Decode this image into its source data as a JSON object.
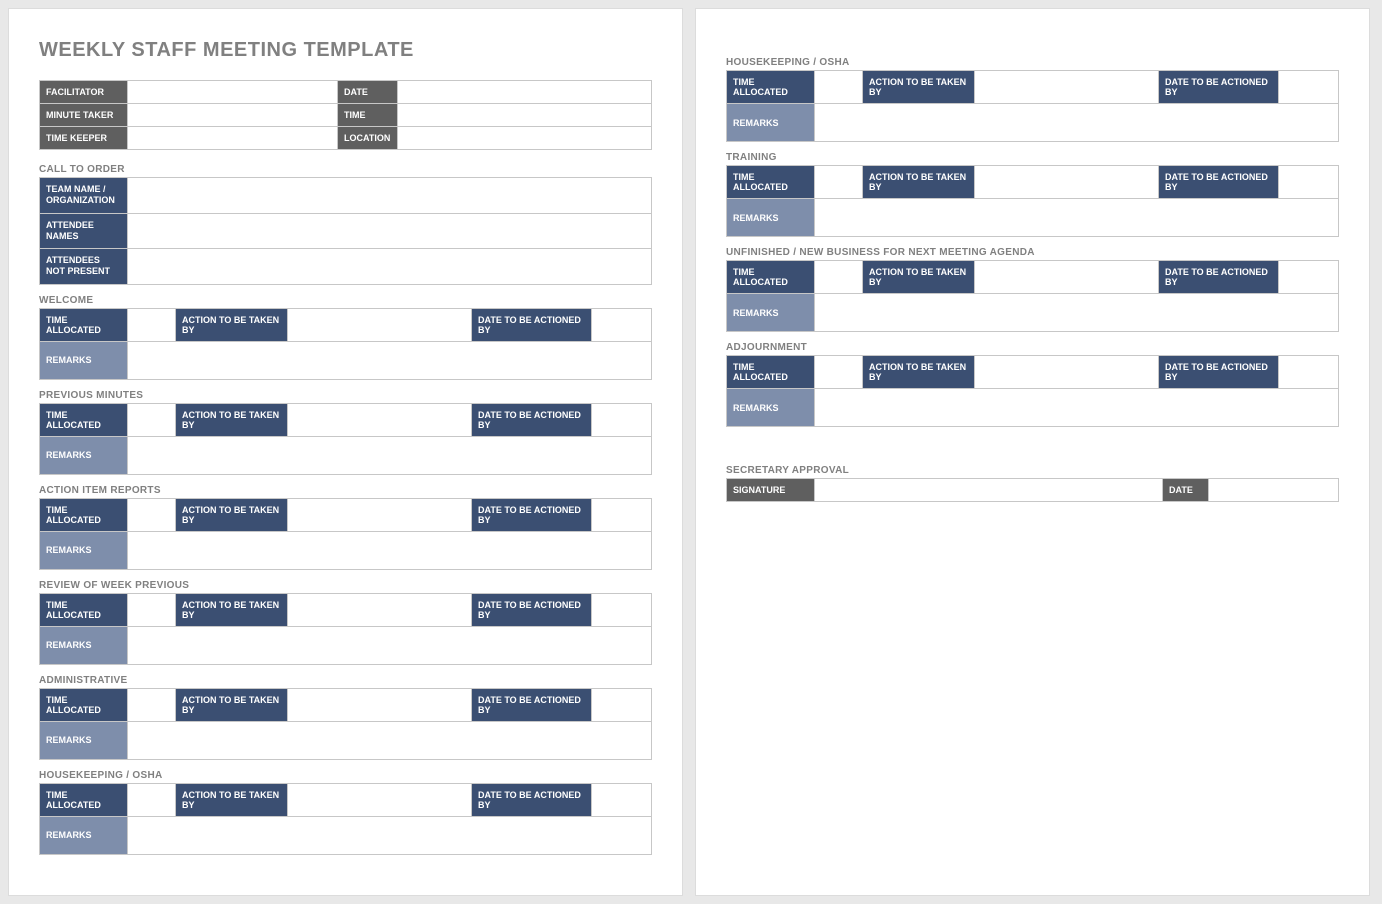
{
  "title": "WEEKLY STAFF MEETING TEMPLATE",
  "header": {
    "facilitator": "FACILITATOR",
    "minute_taker": "MINUTE TAKER",
    "time_keeper": "TIME KEEPER",
    "date": "DATE",
    "time": "TIME",
    "location": "LOCATION"
  },
  "call_to_order": {
    "title": "CALL TO ORDER",
    "team": "TEAM NAME / ORGANIZATION",
    "attendees": "ATTENDEE NAMES",
    "not_present": "ATTENDEES NOT PRESENT"
  },
  "labels": {
    "time_allocated": "TIME ALLOCATED",
    "action_by": "ACTION TO BE TAKEN BY",
    "date_by": "DATE TO BE ACTIONED BY",
    "remarks": "REMARKS"
  },
  "sections_p1": [
    {
      "title": "WELCOME"
    },
    {
      "title": "PREVIOUS MINUTES"
    },
    {
      "title": "ACTION ITEM REPORTS"
    },
    {
      "title": "REVIEW OF WEEK PREVIOUS"
    },
    {
      "title": "ADMINISTRATIVE"
    },
    {
      "title": "HOUSEKEEPING / OSHA"
    }
  ],
  "sections_p2": [
    {
      "title": "HOUSEKEEPING / OSHA"
    },
    {
      "title": "TRAINING"
    },
    {
      "title": "UNFINISHED / NEW BUSINESS FOR NEXT MEETING AGENDA"
    },
    {
      "title": "ADJOURNMENT"
    }
  ],
  "approval": {
    "title": "SECRETARY APPROVAL",
    "signature": "SIGNATURE",
    "date": "DATE"
  }
}
